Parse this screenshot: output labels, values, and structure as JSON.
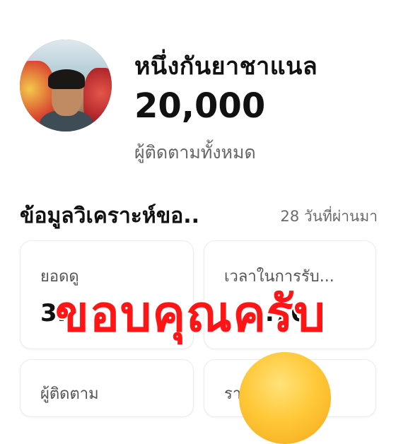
{
  "profile": {
    "username": "หนึ่งกันยาชาแนล",
    "followers_count": "20,000",
    "followers_label": "ผู้ติดตามทั้งหมด"
  },
  "analytics": {
    "title": "ข้อมูลวิเคราะห์ขอ..",
    "period": "28 วันที่ผ่านมา",
    "cards": [
      {
        "label": "ยอดดู",
        "value": "3."
      },
      {
        "label": "เวลาในการรับ...",
        "value": "...70"
      },
      {
        "label": "ผู้ติดตาม",
        "value": ""
      },
      {
        "label": "รา",
        "value": ""
      }
    ]
  },
  "overlay": {
    "text": "ขอบคุณครับ",
    "color": "#ff1515"
  }
}
